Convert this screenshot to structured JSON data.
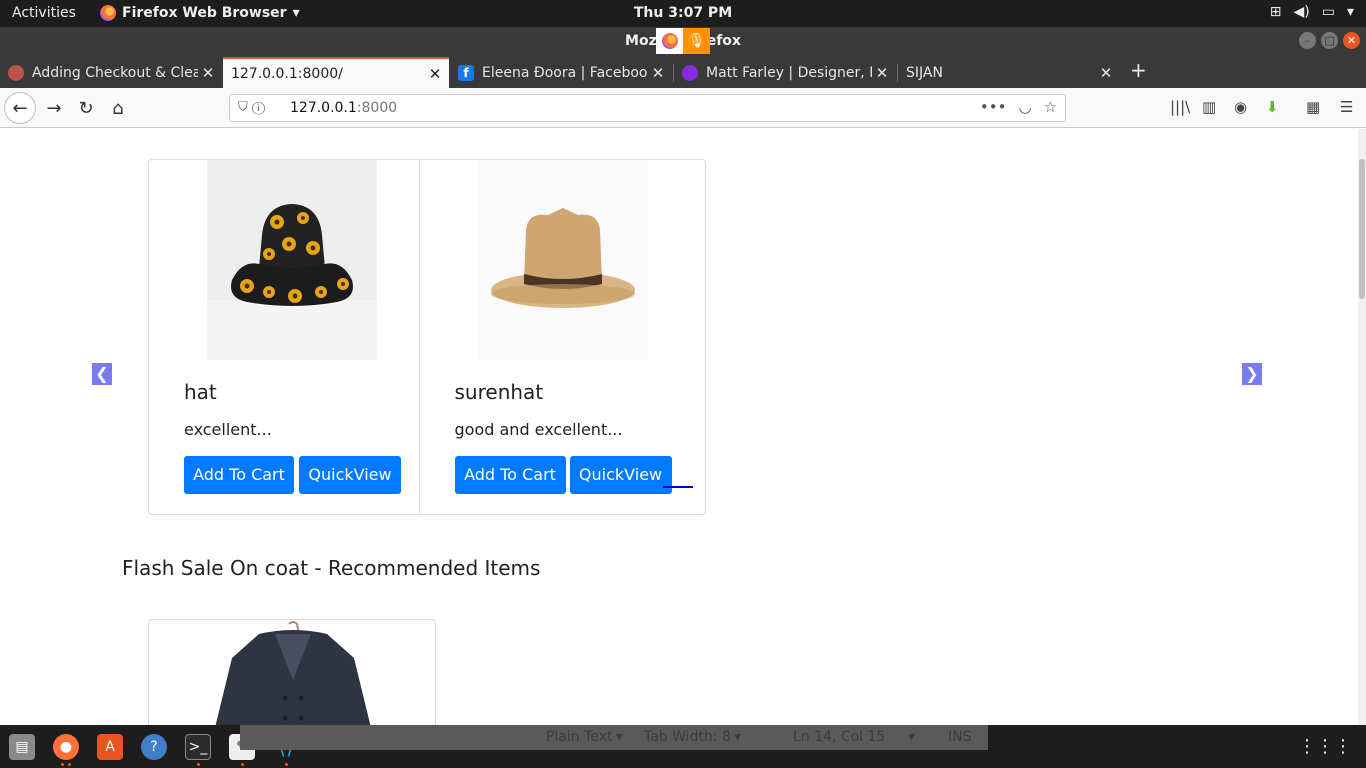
{
  "topbar": {
    "activities": "Activities",
    "app_name": "Firefox Web Browser",
    "clock": "Thu  3:07 PM"
  },
  "window": {
    "title": "Mozilla Firefox"
  },
  "tabs": [
    {
      "label": "Adding Checkout & Clear",
      "favicon_color": "#c0504d"
    },
    {
      "label": "127.0.0.1:8000/",
      "favicon_color": ""
    },
    {
      "label": "Eleena Đoora | Facebook",
      "favicon_color": "#1877f2"
    },
    {
      "label": "Matt Farley | Designer, Fr",
      "favicon_color": "#8a2be2"
    },
    {
      "label": "SIJAN",
      "favicon_color": ""
    }
  ],
  "url": {
    "host": "127.0.0.1",
    "port": ":8000"
  },
  "products": [
    {
      "name": "hat",
      "desc": "excellent...",
      "add_label": "Add To Cart",
      "quick_label": "QuickView"
    },
    {
      "name": "surenhat",
      "desc": "good and excellent...",
      "add_label": "Add To Cart",
      "quick_label": "QuickView"
    }
  ],
  "section_title": "Flash Sale On coat - Recommended Items",
  "statusbar": {
    "mode": "Plain Text",
    "tab_width": "Tab Width: 8",
    "position": "Ln 14, Col 15",
    "ins": "INS"
  },
  "colors": {
    "accent": "#007bff",
    "arrow": "#7b7bf0",
    "ubuntu_orange": "#e95420"
  }
}
